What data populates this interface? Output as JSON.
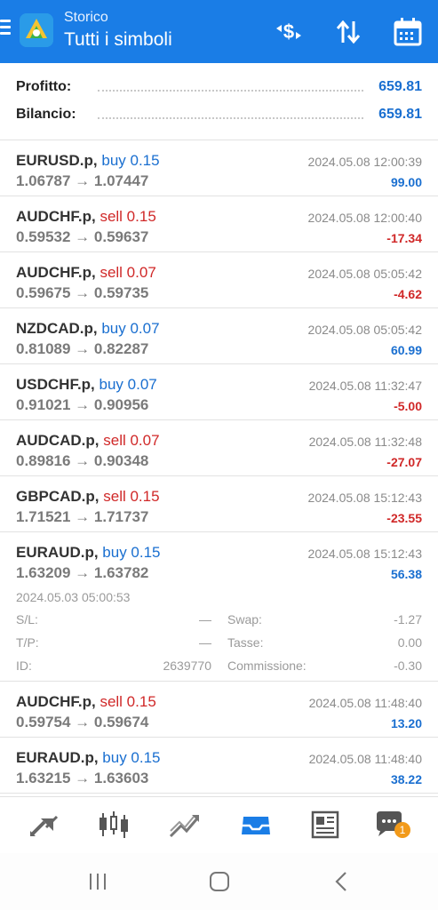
{
  "header": {
    "subtitle": "Storico",
    "title": "Tutti i simboli"
  },
  "summary": {
    "profit_label": "Profitto:",
    "profit_value": "659.81",
    "balance_label": "Bilancio:",
    "balance_value": "659.81"
  },
  "trades": [
    {
      "symbol": "EURUSD.p,",
      "type": "buy 0.15",
      "prices": "1.06787 → 1.07447",
      "time": "2024.05.08 12:00:39",
      "profit": "99.00"
    },
    {
      "symbol": "AUDCHF.p,",
      "type": "sell 0.15",
      "prices": "0.59532 → 0.59637",
      "time": "2024.05.08 12:00:40",
      "profit": "-17.34"
    },
    {
      "symbol": "AUDCHF.p,",
      "type": "sell 0.07",
      "prices": "0.59675 → 0.59735",
      "time": "2024.05.08 05:05:42",
      "profit": "-4.62"
    },
    {
      "symbol": "NZDCAD.p,",
      "type": "buy 0.07",
      "prices": "0.81089 → 0.82287",
      "time": "2024.05.08 05:05:42",
      "profit": "60.99"
    },
    {
      "symbol": "USDCHF.p,",
      "type": "buy 0.07",
      "prices": "0.91021 → 0.90956",
      "time": "2024.05.08 11:32:47",
      "profit": "-5.00"
    },
    {
      "symbol": "AUDCAD.p,",
      "type": "sell 0.07",
      "prices": "0.89816 → 0.90348",
      "time": "2024.05.08 11:32:48",
      "profit": "-27.07"
    },
    {
      "symbol": "GBPCAD.p,",
      "type": "sell 0.15",
      "prices": "1.71521 → 1.71737",
      "time": "2024.05.08 15:12:43",
      "profit": "-23.55"
    },
    {
      "symbol": "EURAUD.p,",
      "type": "buy 0.15",
      "prices": "1.63209 → 1.63782",
      "time": "2024.05.08 15:12:43",
      "profit": "56.38"
    },
    {
      "symbol": "AUDCHF.p,",
      "type": "sell 0.15",
      "prices": "0.59754 → 0.59674",
      "time": "2024.05.08 11:48:40",
      "profit": "13.20"
    },
    {
      "symbol": "EURAUD.p,",
      "type": "buy 0.15",
      "prices": "1.63215 → 1.63603",
      "time": "2024.05.08 11:48:40",
      "profit": "38.22"
    }
  ],
  "expanded_details": {
    "open_time": "2024.05.03 05:00:53",
    "sl_label": "S/L:",
    "sl_value": "—",
    "tp_label": "T/P:",
    "tp_value": "—",
    "id_label": "ID:",
    "id_value": "2639770",
    "swap_label": "Swap:",
    "swap_value": "-1.27",
    "tax_label": "Tasse:",
    "tax_value": "0.00",
    "commission_label": "Commissione:",
    "commission_value": "-0.30"
  },
  "nav": {
    "chat_badge": "1",
    "items": [
      "quotes-icon",
      "chart-icon",
      "trade-icon",
      "history-icon",
      "news-icon",
      "chat-icon"
    ]
  },
  "colors": {
    "header": "#1a7de6",
    "buy": "#1a6fd0",
    "sell": "#d02828",
    "badge": "#f29a1a"
  }
}
